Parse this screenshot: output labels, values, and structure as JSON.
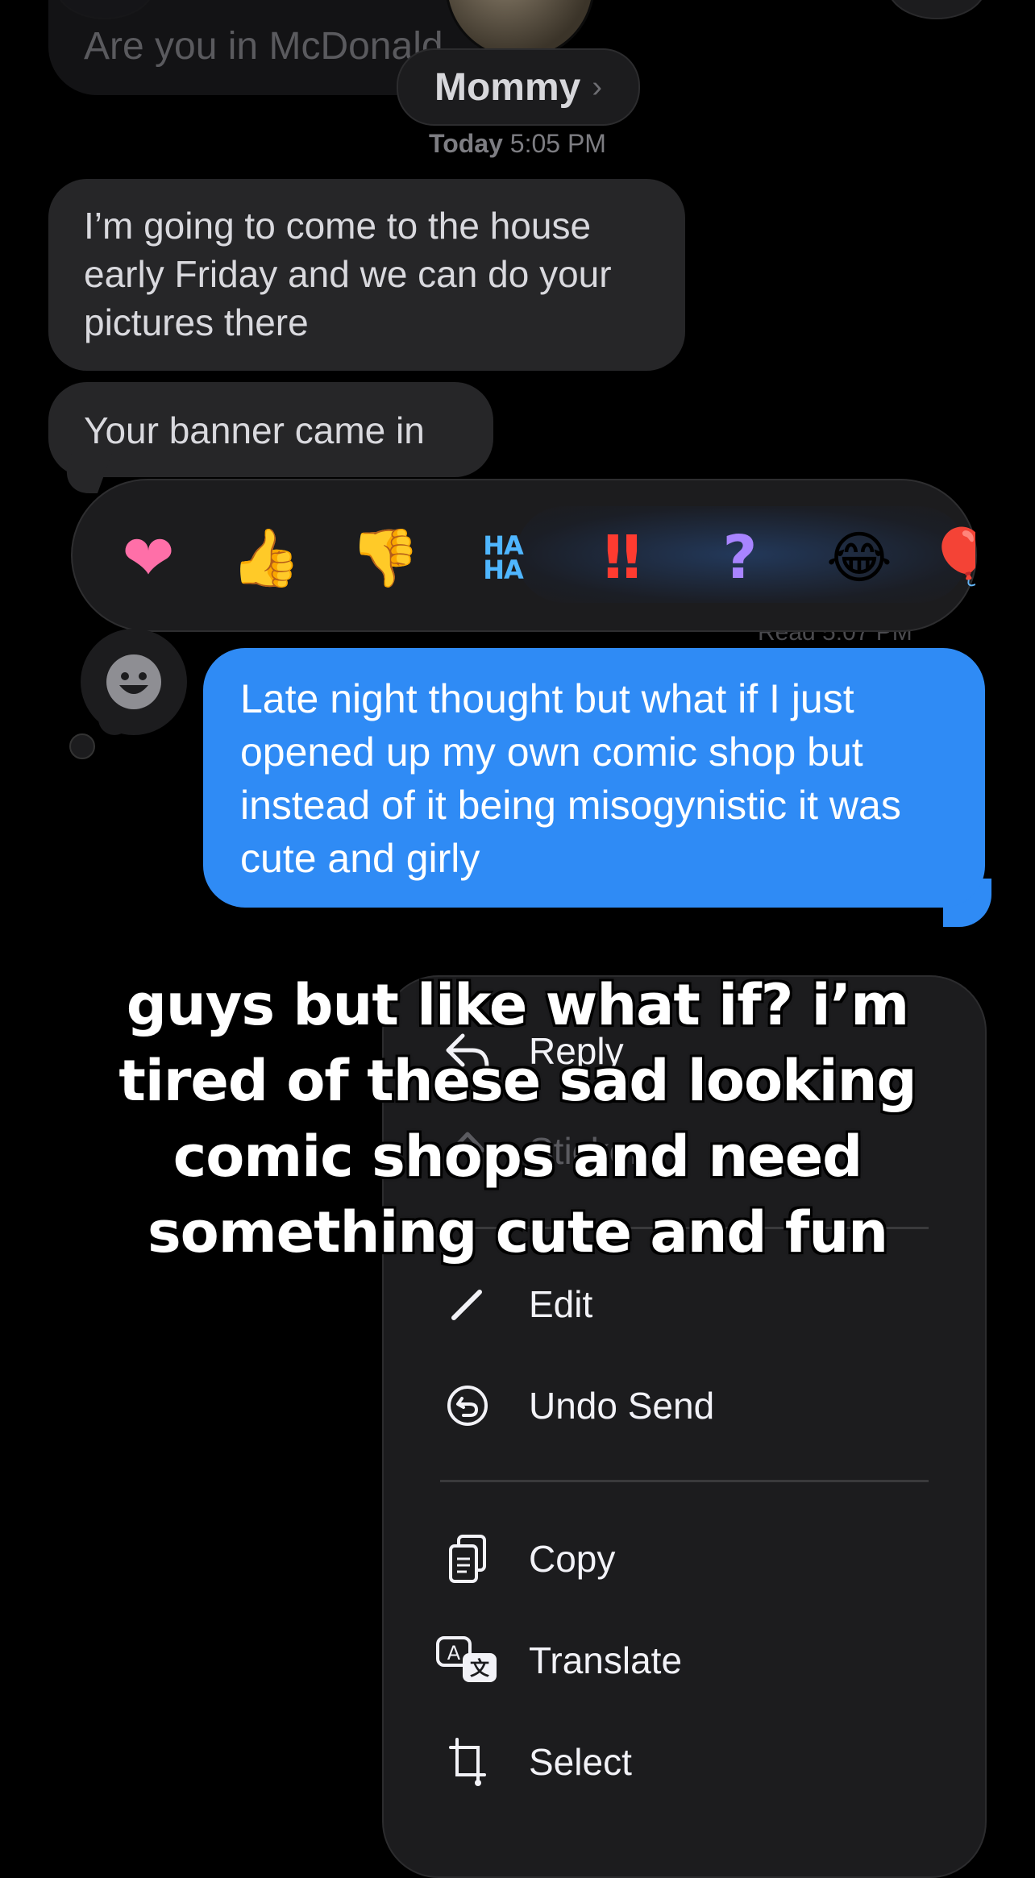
{
  "header": {
    "prev_message_text": "Are you in McDonald",
    "contact_name": "Mommy",
    "contact_chevron": "›",
    "timestamp_day": "Today",
    "timestamp_time": "5:05 PM"
  },
  "messages": {
    "incoming": [
      "I’m going to come to the house early Friday and we can do your pictures there",
      "Your banner came in"
    ],
    "outgoing": "Late night thought but what if I just opened up my own comic shop but instead of it being misogynistic it was cute and girly",
    "read_receipt": "Read 5:07 PM"
  },
  "reactions": {
    "heart": "❤",
    "thumbs_up": "👍",
    "thumbs_down": "👎",
    "haha": "HA HA",
    "emphasis": "‼",
    "question": "?",
    "laughing": "😂",
    "balloon": "🎈",
    "add_reaction": "☻"
  },
  "context_menu": {
    "items": [
      {
        "label": "Reply",
        "icon": "reply-icon"
      },
      {
        "label": "Sticker",
        "icon": "sticker-icon"
      },
      {
        "label": "Edit",
        "icon": "pencil-icon"
      },
      {
        "label": "Undo Send",
        "icon": "undo-icon"
      },
      {
        "label": "Copy",
        "icon": "copy-icon"
      },
      {
        "label": "Translate",
        "icon": "translate-icon"
      },
      {
        "label": "Select",
        "icon": "select-crop-icon"
      }
    ]
  },
  "overlay_caption": "guys but like what if? i’m tired of these sad looking comic shops and need something cute and fun",
  "colors": {
    "outgoing_bubble": "#2f8bf5",
    "incoming_bubble": "#262628",
    "menu_bg": "#1c1c1e",
    "background": "#000000"
  }
}
